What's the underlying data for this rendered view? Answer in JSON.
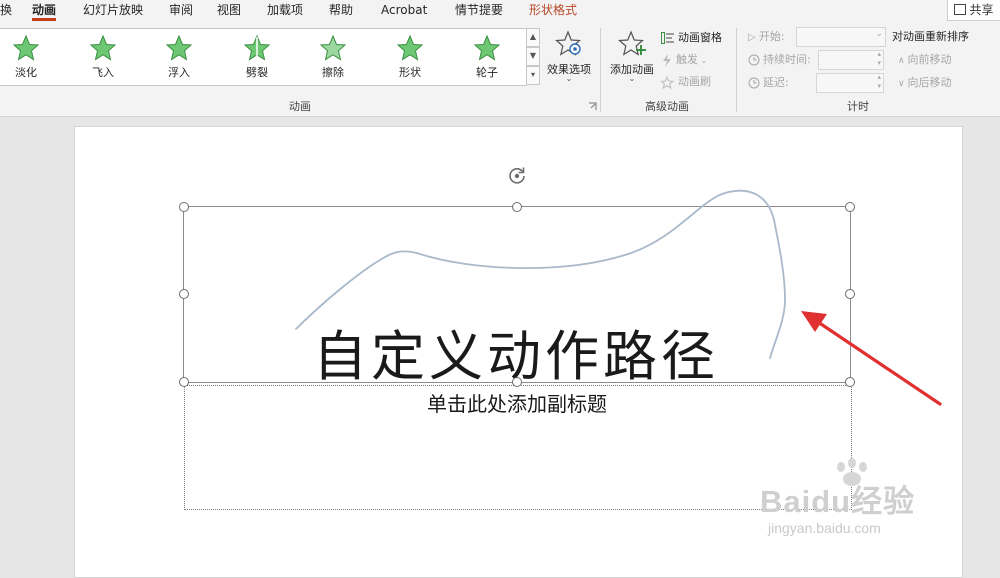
{
  "tabs": [
    "换",
    "动画",
    "幻灯片放映",
    "审阅",
    "视图",
    "加载项",
    "帮助",
    "Acrobat",
    "情节提要",
    "形状格式"
  ],
  "share_label": "共享",
  "animations": {
    "items": [
      "淡化",
      "飞入",
      "浮入",
      "劈裂",
      "擦除",
      "形状",
      "轮子"
    ],
    "effect_options": "效果选项",
    "group_label": "动画"
  },
  "advanced": {
    "add_animation": "添加动画",
    "animation_pane": "动画窗格",
    "trigger": "触发",
    "painter": "动画刷",
    "group_label": "高级动画"
  },
  "timing": {
    "start": "开始:",
    "duration": "持续时间:",
    "delay": "延迟:",
    "reorder": "对动画重新排序",
    "move_earlier": "向前移动",
    "move_later": "向后移动",
    "group_label": "计时"
  },
  "slide": {
    "title": "自定义动作路径",
    "subtitle": "单击此处添加副标题"
  },
  "watermark": {
    "brand": "Baidu经验",
    "url": "jingyan.baidu.com"
  },
  "colors": {
    "accent": "#c43e1c",
    "context_tab": "#b7472a",
    "star_fill": "#5dbb63",
    "path_stroke": "#a9b9c9",
    "arrow": "#e03030"
  }
}
